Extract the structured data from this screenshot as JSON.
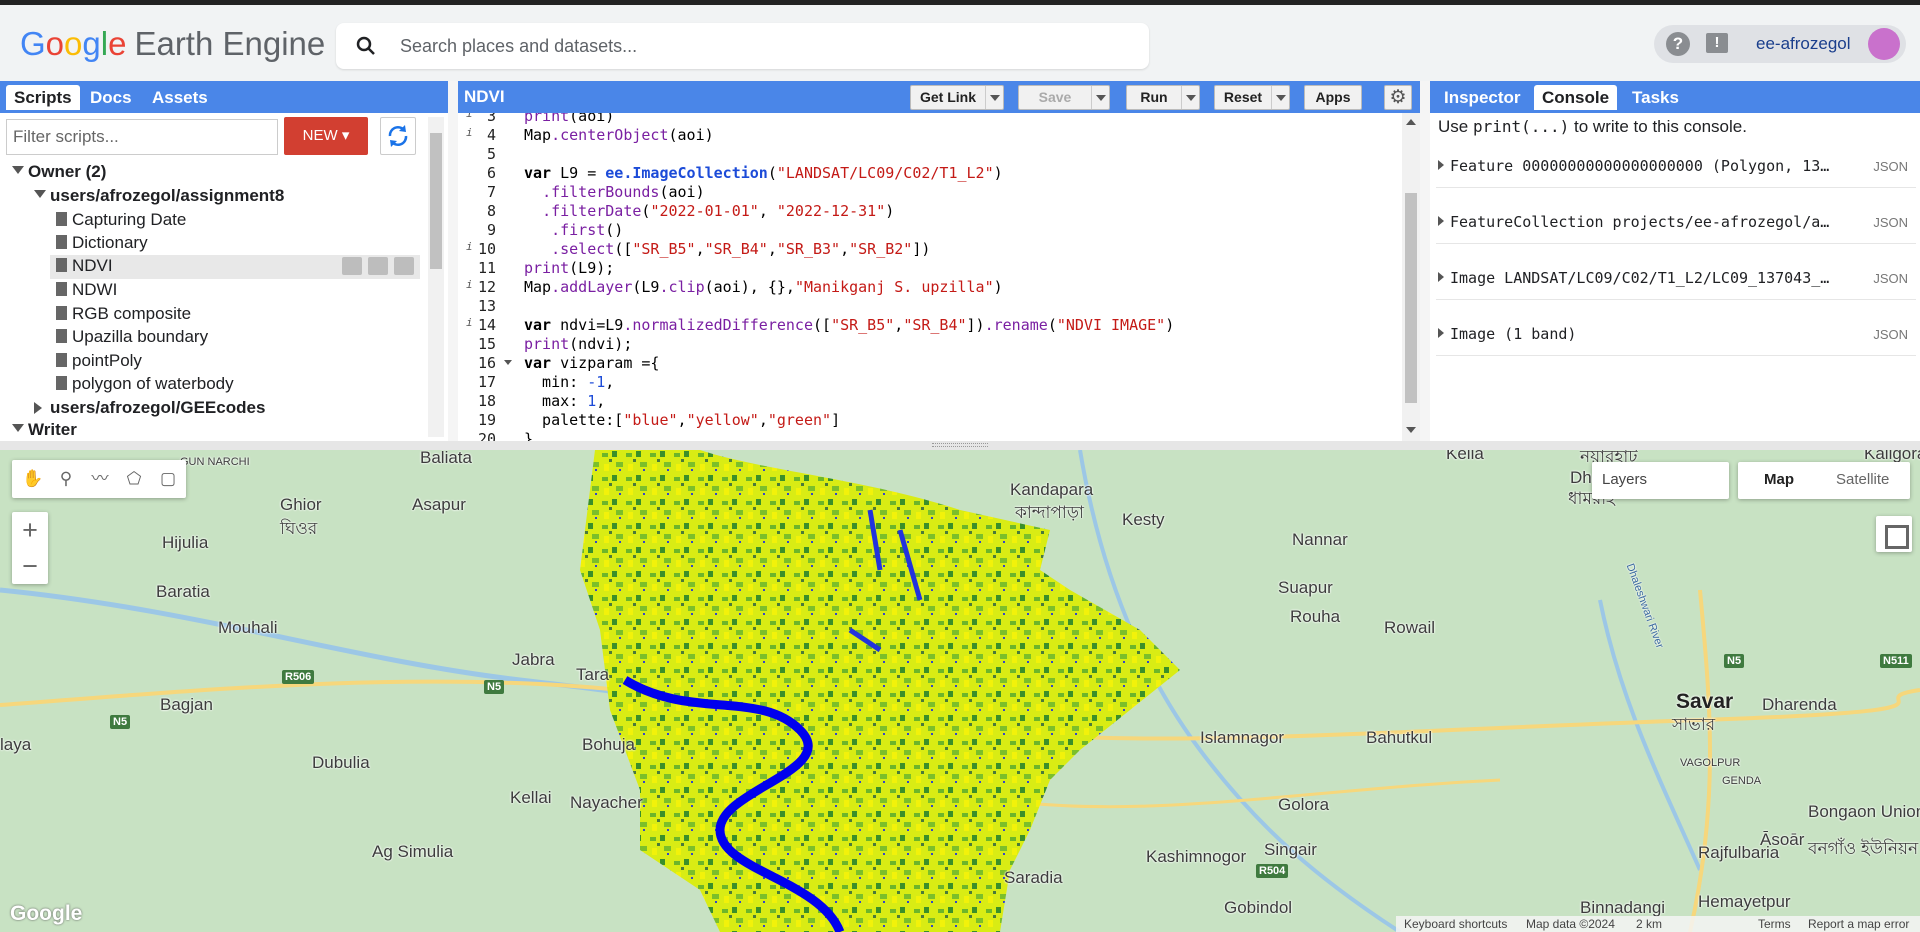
{
  "app": {
    "logo_parts": [
      "G",
      "o",
      "o",
      "g",
      "l",
      "e"
    ],
    "product": "Earth Engine",
    "search_placeholder": "Search places and datasets...",
    "help_symbol": "?",
    "feedback_symbol": "!",
    "username": "ee-afrozegol"
  },
  "left_panel": {
    "tabs": [
      "Scripts",
      "Docs",
      "Assets"
    ],
    "active_tab": "Scripts",
    "filter_placeholder": "Filter scripts...",
    "new_label": "NEW",
    "tree": [
      {
        "label": "Owner (2)",
        "level": 0,
        "kind": "folder",
        "state": "open"
      },
      {
        "label": "users/afrozegol/assignment8",
        "level": 1,
        "kind": "folder",
        "state": "open"
      },
      {
        "label": "Capturing Date",
        "level": 2,
        "kind": "file"
      },
      {
        "label": "Dictionary",
        "level": 2,
        "kind": "file"
      },
      {
        "label": "NDVI",
        "level": 2,
        "kind": "file",
        "selected": true
      },
      {
        "label": "NDWI",
        "level": 2,
        "kind": "file"
      },
      {
        "label": "RGB composite",
        "level": 2,
        "kind": "file"
      },
      {
        "label": "Upazilla boundary",
        "level": 2,
        "kind": "file"
      },
      {
        "label": "pointPoly",
        "level": 2,
        "kind": "file"
      },
      {
        "label": "polygon of waterbody",
        "level": 2,
        "kind": "file"
      },
      {
        "label": "users/afrozegol/GEEcodes",
        "level": 1,
        "kind": "folder",
        "state": "closed"
      },
      {
        "label": "Writer",
        "level": 0,
        "kind": "folder",
        "state": "open"
      }
    ]
  },
  "editor": {
    "title": "NDVI",
    "buttons": {
      "get_link": "Get Link",
      "save": "Save",
      "run": "Run",
      "reset": "Reset",
      "apps": "Apps"
    },
    "lines": [
      {
        "n": "3",
        "info": true,
        "text": "print(aoi)"
      },
      {
        "n": "4",
        "info": true,
        "text": "Map.centerObject(aoi)"
      },
      {
        "n": "5",
        "info": false,
        "text": ""
      },
      {
        "n": "6",
        "info": false,
        "text": "var L9 = ee.ImageCollection(\"LANDSAT/LC09/C02/T1_L2\")"
      },
      {
        "n": "7",
        "info": false,
        "text": "  .filterBounds(aoi)"
      },
      {
        "n": "8",
        "info": false,
        "text": "  .filterDate(\"2022-01-01\", \"2022-12-31\")"
      },
      {
        "n": "9",
        "info": false,
        "text": "   .first()"
      },
      {
        "n": "10",
        "info": true,
        "text": "   .select([\"SR_B5\",\"SR_B4\",\"SR_B3\",\"SR_B2\"])"
      },
      {
        "n": "11",
        "info": false,
        "text": "print(L9);"
      },
      {
        "n": "12",
        "info": true,
        "text": "Map.addLayer(L9.clip(aoi), {},\"Manikganj S. upzilla\")"
      },
      {
        "n": "13",
        "info": false,
        "text": ""
      },
      {
        "n": "14",
        "info": true,
        "text": "var ndvi=L9.normalizedDifference([\"SR_B5\",\"SR_B4\"]).rename(\"NDVI IMAGE\")"
      },
      {
        "n": "15",
        "info": false,
        "text": "print(ndvi);"
      },
      {
        "n": "16",
        "info": false,
        "fold": true,
        "text": "var vizparam ={"
      },
      {
        "n": "17",
        "info": false,
        "text": "  min: -1,"
      },
      {
        "n": "18",
        "info": false,
        "text": "  max: 1,"
      },
      {
        "n": "19",
        "info": false,
        "text": "  palette:[\"blue\",\"yellow\",\"green\"]"
      },
      {
        "n": "20",
        "info": false,
        "text": "}"
      }
    ]
  },
  "right_panel": {
    "tabs": [
      "Inspector",
      "Console",
      "Tasks"
    ],
    "active_tab": "Console",
    "hint_prefix": "Use ",
    "hint_code": "print(...)",
    "hint_suffix": " to write to this console.",
    "entries": [
      {
        "text": "Feature 00000000000000000000 (Polygon, 13…",
        "tag": "JSON"
      },
      {
        "text": "FeatureCollection projects/ee-afrozegol/a…",
        "tag": "JSON"
      },
      {
        "text": "Image LANDSAT/LC09/C02/T1_L2/LC09_137043_…",
        "tag": "JSON"
      },
      {
        "text": "Image (1 band)",
        "tag": "JSON"
      }
    ]
  },
  "map": {
    "layers_label": "Layers",
    "map_type_options": [
      "Map",
      "Satellite"
    ],
    "active_map_type": "Map",
    "zoom_in": "+",
    "zoom_out": "−",
    "places": [
      {
        "name": "Baliata"
      },
      {
        "name": "GUN NARCHI"
      },
      {
        "name": "Ghior"
      },
      {
        "name": "ঘিওর"
      },
      {
        "name": "Asapur"
      },
      {
        "name": "Hijulia"
      },
      {
        "name": "Baratia"
      },
      {
        "name": "Mouhali"
      },
      {
        "name": "Jabra"
      },
      {
        "name": "Tara"
      },
      {
        "name": "Bagjan"
      },
      {
        "name": "Bohuja"
      },
      {
        "name": "laya"
      },
      {
        "name": "Dubulia"
      },
      {
        "name": "Kellai"
      },
      {
        "name": "Nayacher"
      },
      {
        "name": "Ag Simulia"
      },
      {
        "name": "Kandapara"
      },
      {
        "name": "কান্দাপাড়া"
      },
      {
        "name": "Kesty"
      },
      {
        "name": "Kelia"
      },
      {
        "name": "Dhamrai"
      },
      {
        "name": "ধামরাই"
      },
      {
        "name": "নয়ারহাট"
      },
      {
        "name": "Nannar"
      },
      {
        "name": "Suapur"
      },
      {
        "name": "Rouha"
      },
      {
        "name": "Rowail"
      },
      {
        "name": "Islamnagor"
      },
      {
        "name": "Bahutkul"
      },
      {
        "name": "Golora"
      },
      {
        "name": "Kashimnogor"
      },
      {
        "name": "Singair"
      },
      {
        "name": "Saradia"
      },
      {
        "name": "Gobindol"
      },
      {
        "name": "Savar"
      },
      {
        "name": "সাভার"
      },
      {
        "name": "Dharenda"
      },
      {
        "name": "VAGOLPUR"
      },
      {
        "name": "GENDA"
      },
      {
        "name": "Bongaon Union"
      },
      {
        "name": "বনগাঁও ইউনিয়ন"
      },
      {
        "name": "Āsoār"
      },
      {
        "name": "Rajfulbaria"
      },
      {
        "name": "Binnadangi"
      },
      {
        "name": "Hemayetpur"
      },
      {
        "name": "Kaligora"
      },
      {
        "name": "Dhaleshwari River"
      }
    ],
    "roads": [
      "R506",
      "N5",
      "N5",
      "R504",
      "N5",
      "N511"
    ],
    "google_mark": "Google",
    "attribution": {
      "shortcuts": "Keyboard shortcuts",
      "data": "Map data ©2024",
      "scale": "2 km",
      "terms": "Terms",
      "report": "Report a map error"
    }
  }
}
